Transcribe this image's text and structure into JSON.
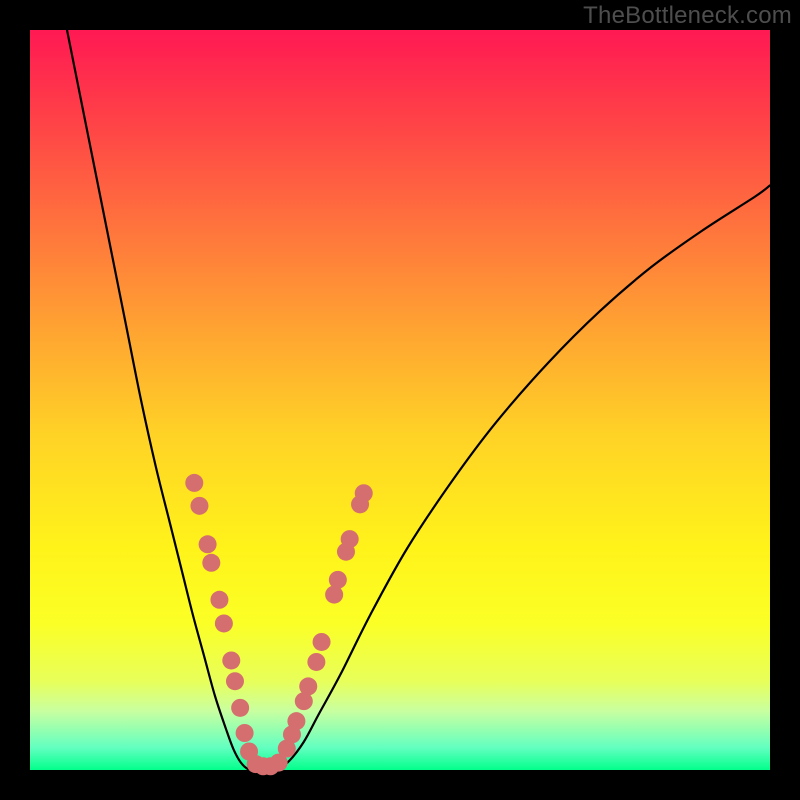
{
  "watermark": "TheBottleneck.com",
  "chart_data": {
    "type": "line",
    "title": "",
    "xlabel": "",
    "ylabel": "",
    "xlim": [
      0,
      100
    ],
    "ylim": [
      0,
      100
    ],
    "gradient_bands": [
      {
        "color": "#ff1953",
        "stop": 0
      },
      {
        "color": "#ff3a49",
        "stop": 10
      },
      {
        "color": "#ff6e3e",
        "stop": 25
      },
      {
        "color": "#ffa232",
        "stop": 40
      },
      {
        "color": "#ffd326",
        "stop": 55
      },
      {
        "color": "#fff31a",
        "stop": 70
      },
      {
        "color": "#fbff25",
        "stop": 80
      },
      {
        "color": "#e8ff5a",
        "stop": 88
      },
      {
        "color": "#c9ffa0",
        "stop": 92
      },
      {
        "color": "#62ffc0",
        "stop": 97
      },
      {
        "color": "#02ff8b",
        "stop": 100
      }
    ],
    "series": [
      {
        "name": "left-branch",
        "x": [
          5,
          7,
          9,
          11,
          13,
          15,
          17,
          19,
          20.5,
          22,
          23.5,
          25,
          26.5,
          27.5,
          28.5,
          29.5
        ],
        "y": [
          100,
          90,
          80,
          70,
          60,
          50,
          41,
          33,
          27,
          21,
          15.5,
          10,
          5.5,
          2.8,
          1.0,
          0.1
        ]
      },
      {
        "name": "valley-floor",
        "x": [
          29.5,
          30.5,
          31.5,
          32.5,
          33.5
        ],
        "y": [
          0.1,
          0.0,
          0.0,
          0.0,
          0.2
        ]
      },
      {
        "name": "right-branch",
        "x": [
          33.5,
          35,
          37,
          39,
          42,
          46,
          51,
          57,
          63,
          70,
          77,
          84,
          91,
          98,
          100
        ],
        "y": [
          0.2,
          1.2,
          3.8,
          7.5,
          13,
          21,
          30,
          39,
          47,
          55,
          62,
          68,
          73,
          77.5,
          79
        ]
      }
    ],
    "scatter_overlay": {
      "name": "highlight-dots",
      "color": "#d56e6e",
      "radius": 9,
      "points": [
        {
          "x": 22.2,
          "y": 38.8
        },
        {
          "x": 22.9,
          "y": 35.7
        },
        {
          "x": 24.0,
          "y": 30.5
        },
        {
          "x": 24.5,
          "y": 28.0
        },
        {
          "x": 25.6,
          "y": 23.0
        },
        {
          "x": 26.2,
          "y": 19.8
        },
        {
          "x": 27.2,
          "y": 14.8
        },
        {
          "x": 27.7,
          "y": 12.0
        },
        {
          "x": 28.4,
          "y": 8.4
        },
        {
          "x": 29.0,
          "y": 5.0
        },
        {
          "x": 29.6,
          "y": 2.5
        },
        {
          "x": 30.5,
          "y": 0.8
        },
        {
          "x": 31.5,
          "y": 0.5
        },
        {
          "x": 32.5,
          "y": 0.5
        },
        {
          "x": 33.6,
          "y": 1.0
        },
        {
          "x": 34.7,
          "y": 2.9
        },
        {
          "x": 35.4,
          "y": 4.8
        },
        {
          "x": 36.0,
          "y": 6.6
        },
        {
          "x": 37.0,
          "y": 9.3
        },
        {
          "x": 37.6,
          "y": 11.3
        },
        {
          "x": 38.7,
          "y": 14.6
        },
        {
          "x": 39.4,
          "y": 17.3
        },
        {
          "x": 41.1,
          "y": 23.7
        },
        {
          "x": 41.6,
          "y": 25.7
        },
        {
          "x": 42.7,
          "y": 29.5
        },
        {
          "x": 43.2,
          "y": 31.2
        },
        {
          "x": 44.6,
          "y": 35.9
        },
        {
          "x": 45.1,
          "y": 37.4
        }
      ]
    }
  }
}
